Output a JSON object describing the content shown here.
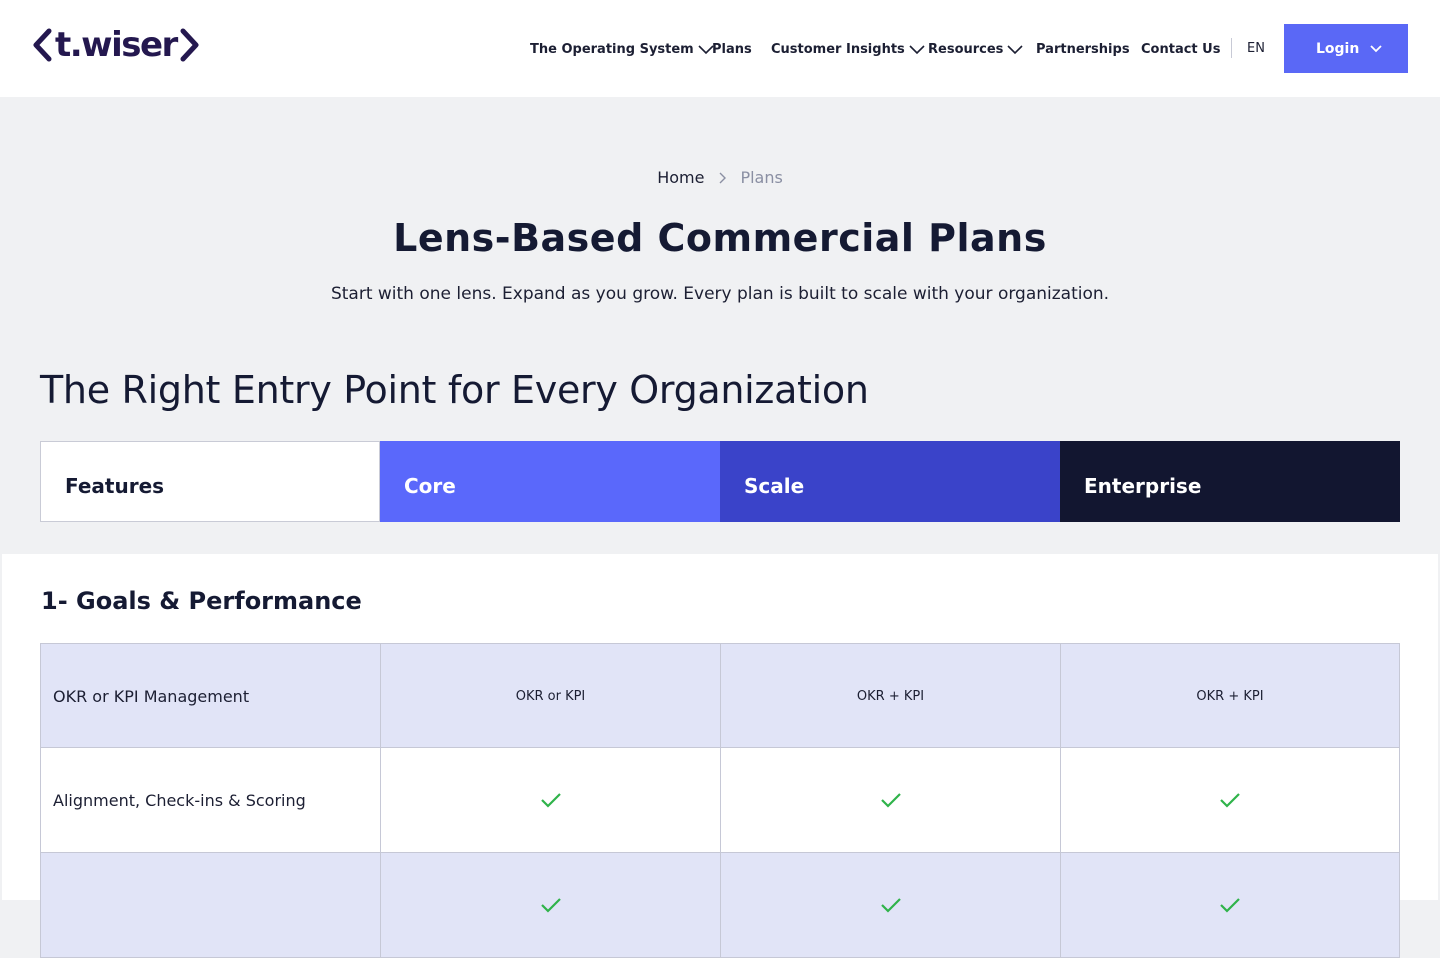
{
  "header": {
    "logo": {
      "text": "t.wiser"
    },
    "nav": [
      {
        "label": "The Operating System",
        "has_dropdown": true
      },
      {
        "label": "Plans",
        "has_dropdown": false
      },
      {
        "label": "Customer Insights",
        "has_dropdown": true
      },
      {
        "label": "Resources",
        "has_dropdown": true
      },
      {
        "label": "Partnerships",
        "has_dropdown": false
      },
      {
        "label": "Contact Us",
        "has_dropdown": false
      }
    ],
    "language": "EN",
    "login_label": "Login"
  },
  "breadcrumb": {
    "home": "Home",
    "current": "Plans"
  },
  "hero": {
    "title": "Lens-Based Commercial Plans",
    "subtitle": "Start with one lens. Expand as you grow. Every plan is built to scale with your organization."
  },
  "section_title": "The Right Entry Point for Every Organization",
  "plans": {
    "features_label": "Features",
    "columns": [
      {
        "name": "Core",
        "color": "#5a68fb"
      },
      {
        "name": "Scale",
        "color": "#3a43c9"
      },
      {
        "name": "Enterprise",
        "color": "#121630"
      }
    ]
  },
  "groups": [
    {
      "title": "1- Goals & Performance",
      "rows": [
        {
          "feature": "OKR or KPI Management",
          "values": [
            "OKR or KPI",
            "OKR + KPI",
            "OKR + KPI"
          ]
        },
        {
          "feature": "Alignment, Check-ins & Scoring",
          "values": [
            "check",
            "check",
            "check"
          ]
        },
        {
          "feature": "",
          "values": [
            "check",
            "check",
            "check"
          ]
        }
      ]
    }
  ],
  "colors": {
    "accent": "#5a68f6",
    "check": "#2fb34a",
    "shaded_row": "#e1e4f7"
  }
}
